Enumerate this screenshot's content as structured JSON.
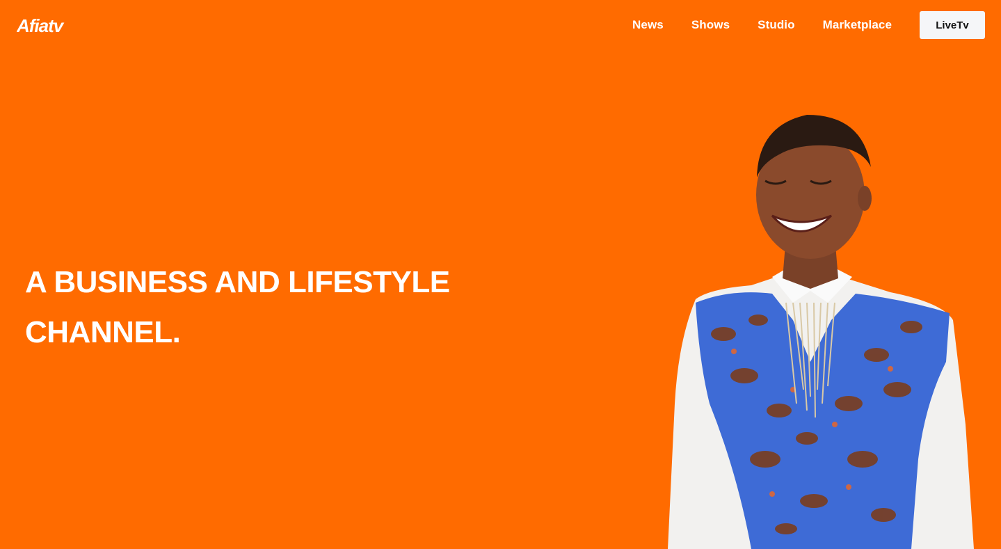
{
  "header": {
    "logo_text": "Afiatv",
    "nav": [
      {
        "label": "News"
      },
      {
        "label": "Shows"
      },
      {
        "label": "Studio"
      },
      {
        "label": "Marketplace"
      }
    ],
    "cta_label": "LiveTv"
  },
  "hero": {
    "title_line1": "A BUSINESS AND LIFESTYLE",
    "title_line2": "CHANNEL.",
    "image_icon": "smiling-woman-photo"
  },
  "colors": {
    "background": "#FF6B00",
    "text": "#FFFFFF",
    "button_bg": "#F5F6F8",
    "button_text": "#111111"
  }
}
